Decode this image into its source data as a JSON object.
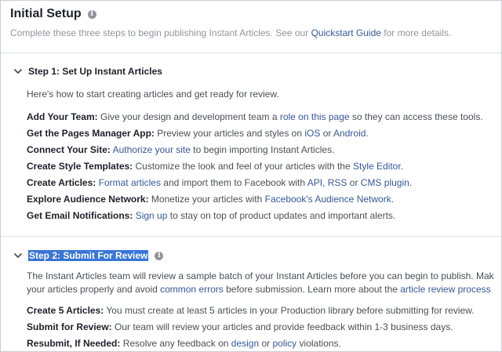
{
  "header": {
    "title": "Initial Setup",
    "subtitle_prefix": "Complete these three steps to begin publishing Instant Articles. See our ",
    "subtitle_link": "Quickstart Guide",
    "subtitle_suffix": " for more details."
  },
  "step1": {
    "title": "Step 1: Set Up Instant Articles",
    "intro": "Here's how to start creating articles and get ready for review.",
    "rows": [
      {
        "label": "Add Your Team:",
        "a": " Give your design and development team a ",
        "l1": "role on this page",
        "b": " so they can access these tools."
      },
      {
        "label": "Get the Pages Manager App:",
        "a": " Preview your articles and styles on ",
        "l1": "iOS",
        "b": " or ",
        "l2": "Android",
        "c": "."
      },
      {
        "label": "Connect Your Site:",
        "a": " ",
        "l1": "Authorize your site",
        "b": " to begin importing Instant Articles."
      },
      {
        "label": "Create Style Templates:",
        "a": " Customize the look and feel of your articles with the ",
        "l1": "Style Editor",
        "b": "."
      },
      {
        "label": "Create Articles:",
        "a": " ",
        "l1": "Format articles",
        "b": " and import them to Facebook with ",
        "l2": "API",
        "c": ", ",
        "l3": "RSS",
        "d": " or ",
        "l4": "CMS plugin",
        "e": "."
      },
      {
        "label": "Explore Audience Network:",
        "a": " Monetize your articles with ",
        "l1": "Facebook's Audience Network",
        "b": "."
      },
      {
        "label": "Get Email Notifications:",
        "a": " ",
        "l1": "Sign up",
        "b": " to stay on top of product updates and important alerts."
      }
    ]
  },
  "step2": {
    "title": "Step 2: Submit For Review",
    "intro1": "The Instant Articles team will review a sample batch of your Instant Articles before you can begin to publish. Mak",
    "intro2_a": "your articles properly and avoid ",
    "intro2_link1": "common errors",
    "intro2_b": " before submission. Learn more about the ",
    "intro2_link2": "article review process",
    "rows": [
      {
        "label": "Create 5 Articles:",
        "a": " You must create at least 5 articles in your Production library before submitting for review."
      },
      {
        "label": "Submit for Review:",
        "a": " Our team will review your articles and provide feedback within 1-3 business days."
      },
      {
        "label": "Resubmit, If Needed:",
        "a": " Resolve any feedback on ",
        "l1": "design",
        "b": " or ",
        "l2": "policy",
        "c": " violations."
      }
    ]
  }
}
